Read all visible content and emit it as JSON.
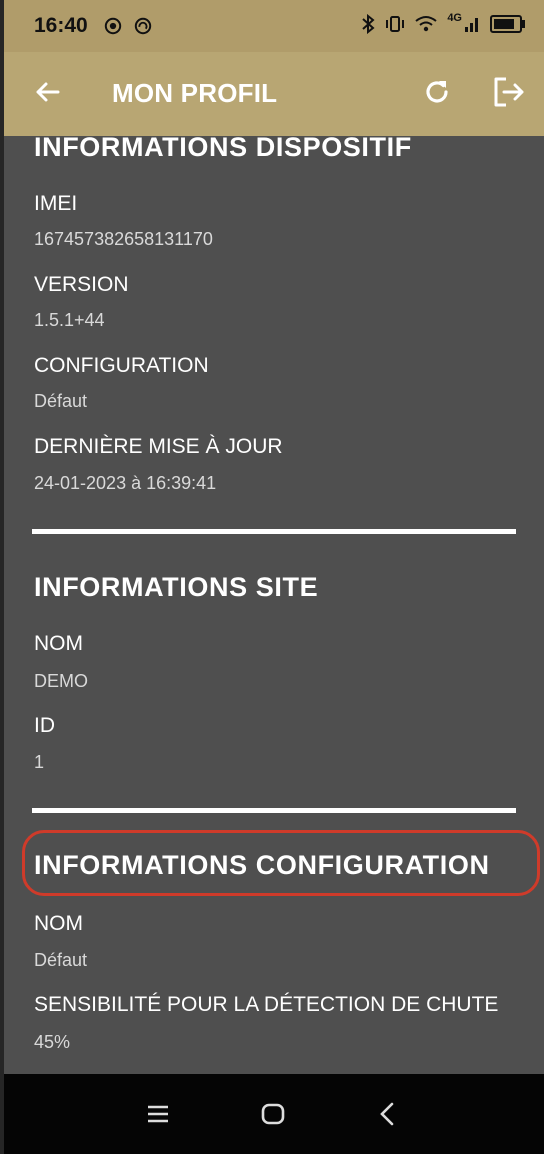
{
  "status_bar": {
    "time": "16:40",
    "network": "4G"
  },
  "app_bar": {
    "title": "MON PROFIL"
  },
  "device_section": {
    "title": "INFORMATIONS DISPOSITIF",
    "fields": [
      {
        "label": "IMEI",
        "value": "167457382658131170"
      },
      {
        "label": "VERSION",
        "value": "1.5.1+44"
      },
      {
        "label": "CONFIGURATION",
        "value": "Défaut"
      },
      {
        "label": "DERNIÈRE MISE À JOUR",
        "value": "24-01-2023 à 16:39:41"
      }
    ]
  },
  "site_section": {
    "title": "INFORMATIONS SITE",
    "fields": [
      {
        "label": "NOM",
        "value": "DEMO"
      },
      {
        "label": "ID",
        "value": "1"
      }
    ]
  },
  "config_section": {
    "title": "INFORMATIONS CONFIGURATION",
    "fields": [
      {
        "label": "NOM",
        "value": "Défaut"
      },
      {
        "label": "SENSIBILITÉ POUR LA DÉTECTION DE CHUTE",
        "value": "45%"
      }
    ]
  },
  "colors": {
    "app_bar": "#b8a673",
    "status_bar": "#b09c6a",
    "background": "#4f4f4f",
    "highlight": "#cf3b2a"
  },
  "icons": [
    "back-arrow-icon",
    "refresh-icon",
    "logout-icon",
    "recents-icon",
    "home-icon",
    "back-nav-icon"
  ]
}
